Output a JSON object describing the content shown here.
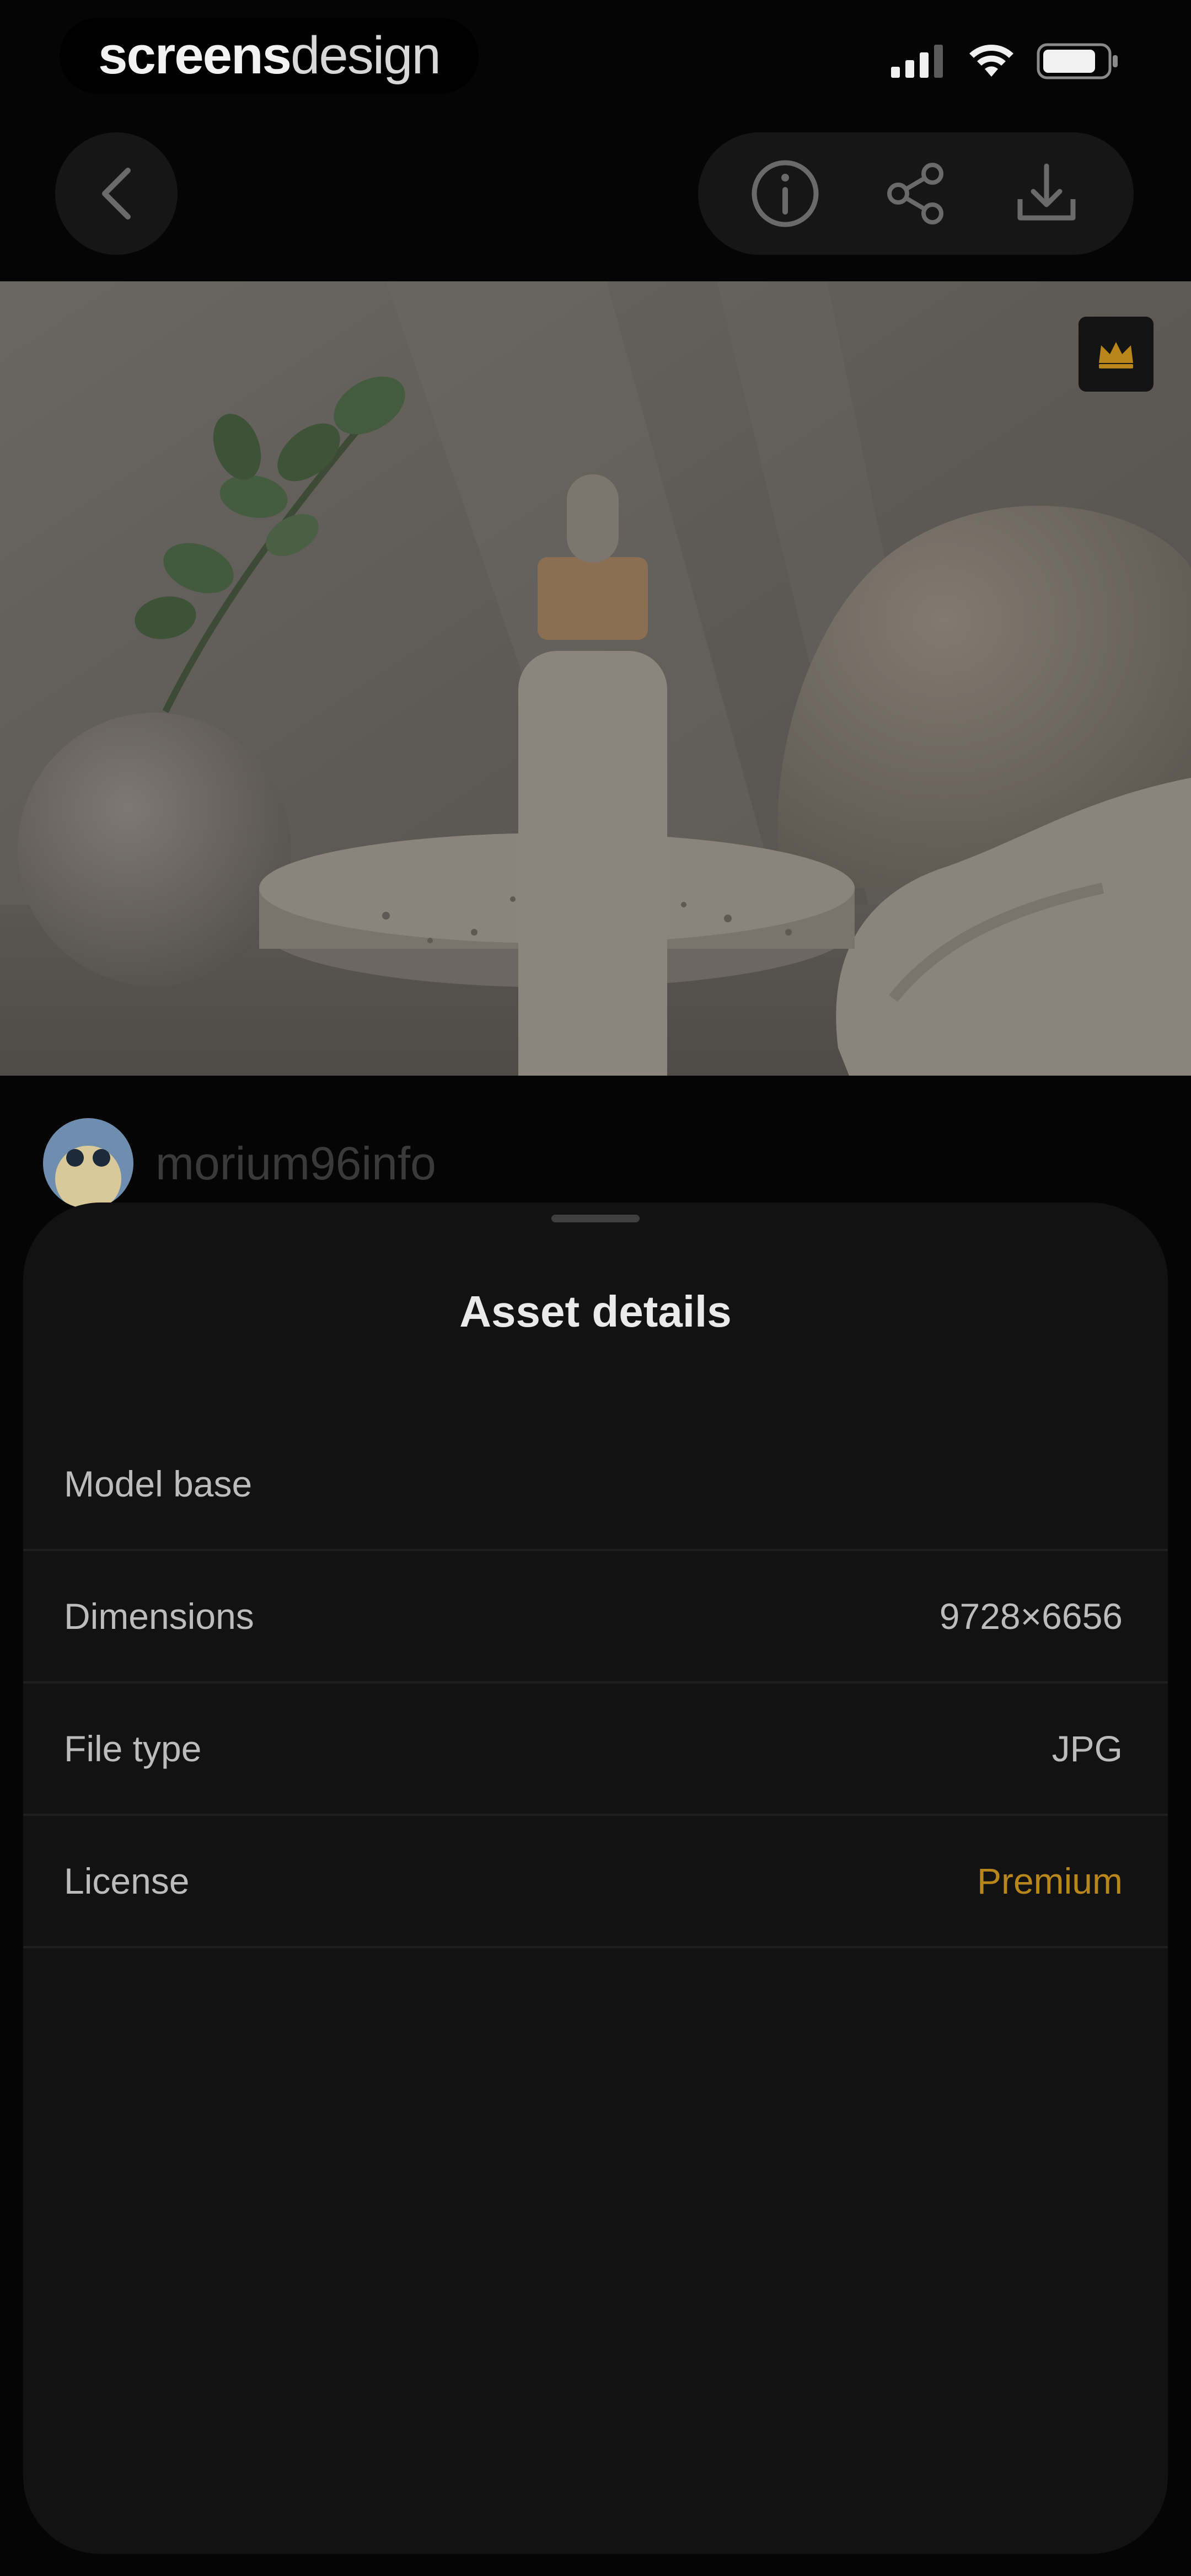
{
  "status_bar": {
    "brand_bold": "screens",
    "brand_light": "design"
  },
  "nav": {
    "back_icon": "chevron-left-icon",
    "actions": [
      "info-icon",
      "share-icon",
      "download-icon"
    ]
  },
  "asset": {
    "badge_icon": "crown-icon",
    "author": "morium96info"
  },
  "sheet": {
    "title": "Asset details",
    "rows": [
      {
        "label": "Model base",
        "value": ""
      },
      {
        "label": "Dimensions",
        "value": "9728×6656"
      },
      {
        "label": "File type",
        "value": "JPG"
      },
      {
        "label": "License",
        "value": "Premium"
      }
    ]
  },
  "colors": {
    "background": "#050505",
    "sheet": "#121212",
    "premium": "#b8861a"
  }
}
